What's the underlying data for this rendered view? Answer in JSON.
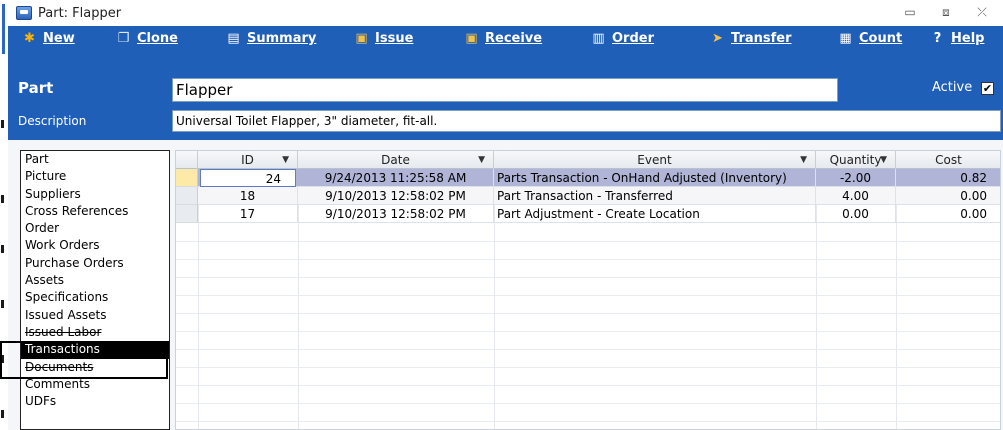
{
  "window": {
    "title": "Part: Flapper",
    "icon": "app-icon"
  },
  "toolbar": {
    "buttons": [
      {
        "label": "New",
        "icon": "asterisk-icon"
      },
      {
        "label": "Clone",
        "icon": "clone-icon"
      },
      {
        "label": "Summary",
        "icon": "summary-icon"
      },
      {
        "label": "Issue",
        "icon": "issue-icon"
      },
      {
        "label": "Receive",
        "icon": "receive-icon"
      },
      {
        "label": "Order",
        "icon": "order-icon"
      },
      {
        "label": "Transfer",
        "icon": "transfer-icon"
      },
      {
        "label": "Count",
        "icon": "count-icon"
      },
      {
        "label": "Help",
        "icon": "help-icon"
      }
    ]
  },
  "header": {
    "part_label": "Part",
    "part_value": "Flapper",
    "active_label": "Active",
    "active_checked": "✔",
    "description_label": "Description",
    "description_value": "Universal Toilet Flapper, 3\" diameter, fit-all."
  },
  "nav": {
    "items": [
      "Part",
      "Picture",
      "Suppliers",
      "Cross References",
      "Order",
      "Work Orders",
      "Purchase Orders",
      "Assets",
      "Specifications",
      "Issued Assets",
      "Issued Labor",
      "Transactions",
      "Documents",
      "Comments",
      "UDFs"
    ],
    "selected": "Transactions"
  },
  "grid": {
    "columns": [
      "ID",
      "Date",
      "Event",
      "Quantity",
      "Cost"
    ],
    "rows": [
      {
        "id": "24",
        "date": "9/24/2013 11:25:58 AM",
        "event": "Parts Transaction - OnHand Adjusted (Inventory)",
        "quantity": "-2.00",
        "cost": "0.82"
      },
      {
        "id": "18",
        "date": "9/10/2013 12:58:02 PM",
        "event": "Part Transaction - Transferred",
        "quantity": "4.00",
        "cost": "0.00"
      },
      {
        "id": "17",
        "date": "9/10/2013 12:58:02 PM",
        "event": "Part Adjustment - Create Location",
        "quantity": "0.00",
        "cost": "0.00"
      }
    ]
  },
  "colors": {
    "accent": "#1f5fb8",
    "selected_row": "#b0b4d6"
  }
}
